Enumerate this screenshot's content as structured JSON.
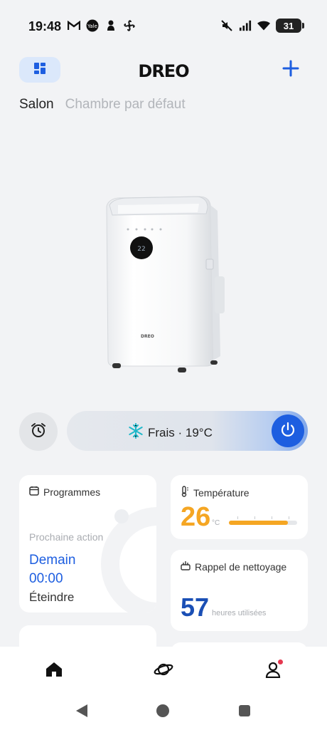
{
  "status_bar": {
    "time": "19:48",
    "left_icons": [
      "gmail-icon",
      "yale-icon",
      "notification-icon",
      "fan-icon"
    ],
    "right_icons": [
      "mute-icon",
      "signal-icon",
      "wifi-icon"
    ],
    "battery": "31"
  },
  "header": {
    "brand": "DREO",
    "layout_icon": "grid-layout-icon",
    "add_icon": "plus-icon"
  },
  "rooms": {
    "active": "Salon",
    "inactive": "Chambre par défaut"
  },
  "device": {
    "mode_icon": "snowflake-icon",
    "mode_label": "Frais · 19°C",
    "power_on": true
  },
  "programmes": {
    "title": "Programmes",
    "next_label": "Prochaine action",
    "next_day": "Demain",
    "next_time": "00:00",
    "next_action": "Éteindre"
  },
  "temperature": {
    "title": "Température",
    "value": "26",
    "unit": "°C",
    "level": 0.86
  },
  "cleaning": {
    "title": "Rappel de nettoyage",
    "value": "57",
    "unit": "heures utilisées"
  },
  "bottom_nav": {
    "items": [
      "home-icon",
      "explore-icon",
      "profile-icon"
    ],
    "active": "home",
    "profile_badge": true
  },
  "colors": {
    "accent_blue": "#1d5ee0",
    "temperature_orange": "#f5a623"
  }
}
